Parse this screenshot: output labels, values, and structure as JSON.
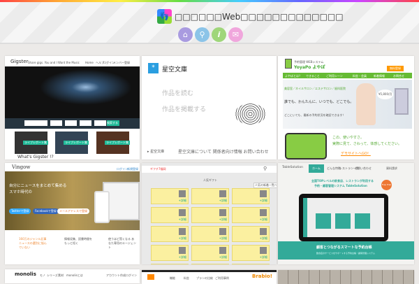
{
  "header": {
    "title": "□□□□□□Web□□□□□□□□□□□□□",
    "nav": [
      {
        "icon": "home-icon",
        "color": "#a99be0",
        "glyph": "⌂"
      },
      {
        "icon": "search-icon",
        "color": "#8cc4e8",
        "glyph": "⚲"
      },
      {
        "icon": "info-icon",
        "color": "#9fd67a",
        "glyph": "i"
      },
      {
        "icon": "mail-icon",
        "color": "#f0a6dc",
        "glyph": "✉"
      }
    ]
  },
  "cards": {
    "gigster": {
      "brand": "Gigster",
      "tagline": "Share gigs. You and I Want the Music",
      "nav": [
        "Home",
        "ヘルプ",
        "ログイン",
        "メンバー登録"
      ],
      "heading": "What's Gigster !?",
      "button": "ライブレポート集",
      "search": "検索する"
    },
    "aozora": {
      "brand": "星空文庫",
      "links": [
        "作品を読む",
        "作品を掲載する"
      ],
      "footer_left": "▸ 星空文庫",
      "footer_right": "星空文庫について 関係者向け情報 お問い合わせ"
    },
    "yoyapo": {
      "brand": "YoyaPo よやぽ",
      "sub": "予約管理 WEBシステム",
      "button": "無料登録",
      "menu": [
        "よやぽとは？",
        "できること",
        "ご利用シーン",
        "料金・会員",
        "新着情報",
        "お問合せ"
      ],
      "hero1": "美容室／ネイルサロン／エステサロン／歯科医院",
      "hero2": "誰でも、かんたんに、いつでも、どこでも。",
      "hero3": "どこにいても、最新の予約状況を確認できます！",
      "price": "¥5,800/月",
      "lead1": "この、使いやすさ。",
      "lead2": "実際に見て、さわって、体感してください。",
      "demo": "デモサイトへGO！"
    },
    "vingow": {
      "brand": "Vingow",
      "nav": [
        "ログイン",
        "新規登録"
      ],
      "headline1": "自分にニュースをまとめて集める",
      "headline2": "スマホ時代の",
      "twitter": "Twitterで登録",
      "facebook": "Facebookで登録",
      "mail": "メールアドレスで登録",
      "features": [
        "160万のジャンル記事 ニュースの選別に悩んでいない",
        "情報収集、読書時間を もっと短く",
        "使うほど賢くなる あなた専用のエージェント"
      ]
    },
    "gift": {
      "brand": "ギフチ7福岡",
      "heading": "人気ギフト",
      "sort": "人気の新着一覧へ",
      "more": "+詳細"
    },
    "tablesolution": {
      "brand": "TableSolution",
      "nav": [
        "ホーム",
        "どんな特徴",
        "レストラン一覧",
        "お問い合わせ",
        "資料請求"
      ],
      "headline1": "全国TOPレベルの飲食店、レストランが利用する",
      "headline2": "予約・顧客管理システム TableSolution",
      "banner": "顧客とつながるスマートな予約台帳",
      "banner_sub": "飲食店のサービスをサポートする予約台帳・顧客管理システム",
      "badge": "Free Trial"
    },
    "monolis": {
      "brand": "monolis",
      "nav": [
        "モノ",
        "シリーズ",
        "素材",
        "monolisとは"
      ],
      "right": [
        "アカウント作成",
        "ログイン"
      ]
    },
    "brabio": {
      "brand": "Brabio!",
      "nav": [
        "機能",
        "料金",
        "プランの比較",
        "ご利用事例"
      ]
    }
  }
}
